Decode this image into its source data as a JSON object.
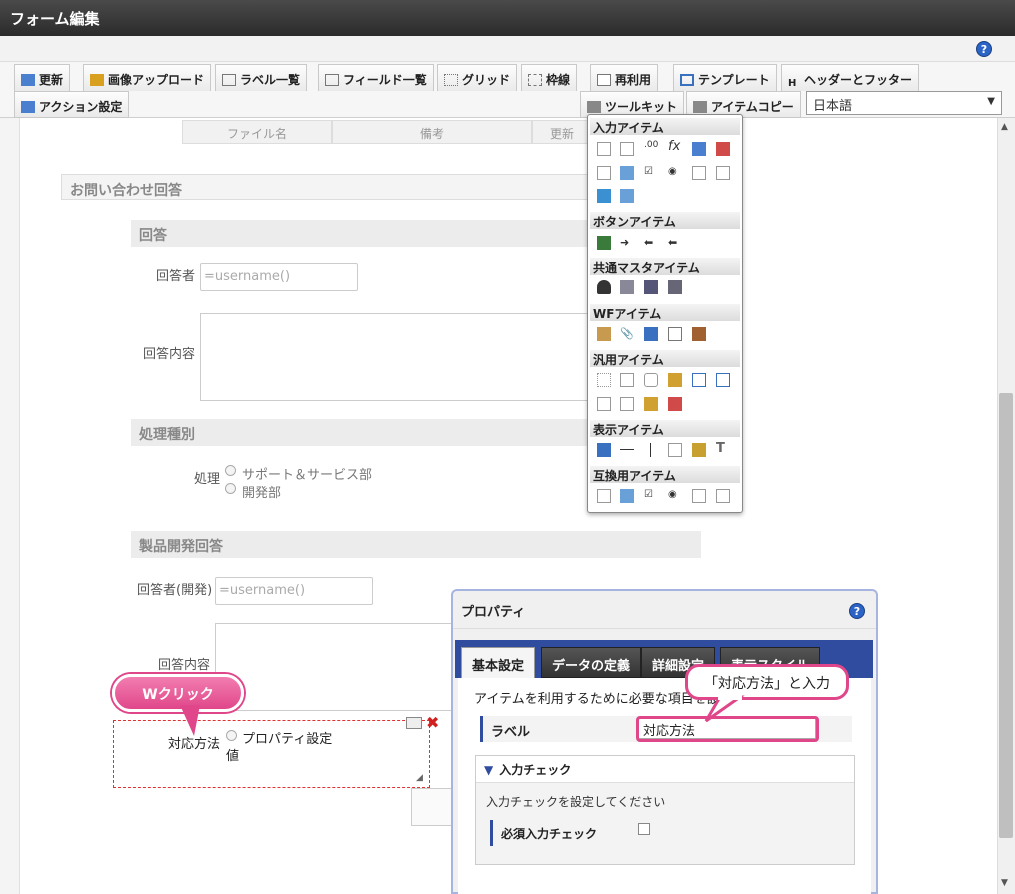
{
  "window": {
    "title": "フォーム編集",
    "help_label": "?"
  },
  "toolbar": {
    "row1": [
      "更新",
      "画像アップロード",
      "ラベル一覧",
      "フィールド一覧",
      "グリッド",
      "枠線",
      "再利用",
      "テンプレート",
      "ヘッダーとフッター"
    ],
    "row2_left": "アクション設定",
    "toolkit": "ツールキット",
    "itemcopy": "アイテムコピー",
    "language": "日本語"
  },
  "table_headers": [
    "ファイル名",
    "備考",
    "更新"
  ],
  "form": {
    "section_inquiry": "お問い合わせ回答",
    "section_answer": "回答",
    "respondent_label": "回答者",
    "respondent_value": "=username()",
    "content_label": "回答内容",
    "section_type": "処理種別",
    "process_label": "処理",
    "process_options": [
      "サポート＆サービス部",
      "開発部"
    ],
    "section_dev": "製品開発回答",
    "dev_respondent_label": "回答者(開発)",
    "dev_respondent_value": "=username()",
    "dev_content_label": "回答内容",
    "selected_label": "対応方法",
    "selected_option": "プロパティ設定",
    "selected_option2": "値"
  },
  "palette": {
    "sections": [
      "入力アイテム",
      "ボタンアイテム",
      "共通マスタアイテム",
      "WFアイテム",
      "汎用アイテム",
      "表示アイテム",
      "互換用アイテム"
    ]
  },
  "properties": {
    "title": "プロパティ",
    "help": "?",
    "tabs": [
      "基本設定",
      "データの定義",
      "詳細設定",
      "表示スタイル"
    ],
    "description": "アイテムを利用するために必要な項目を設",
    "label_field": "ラベル",
    "label_value": "対応方法",
    "input_check_header": "入力チェック",
    "input_check_desc": "入力チェックを設定してください",
    "required_check": "必須入力チェック"
  },
  "annotations": {
    "dblclick": "Wクリック",
    "enter": "「対応方法」と入力"
  },
  "colors": {
    "accent": "#2f4c9e",
    "callout": "#e0478a",
    "selection": "#e03030"
  }
}
